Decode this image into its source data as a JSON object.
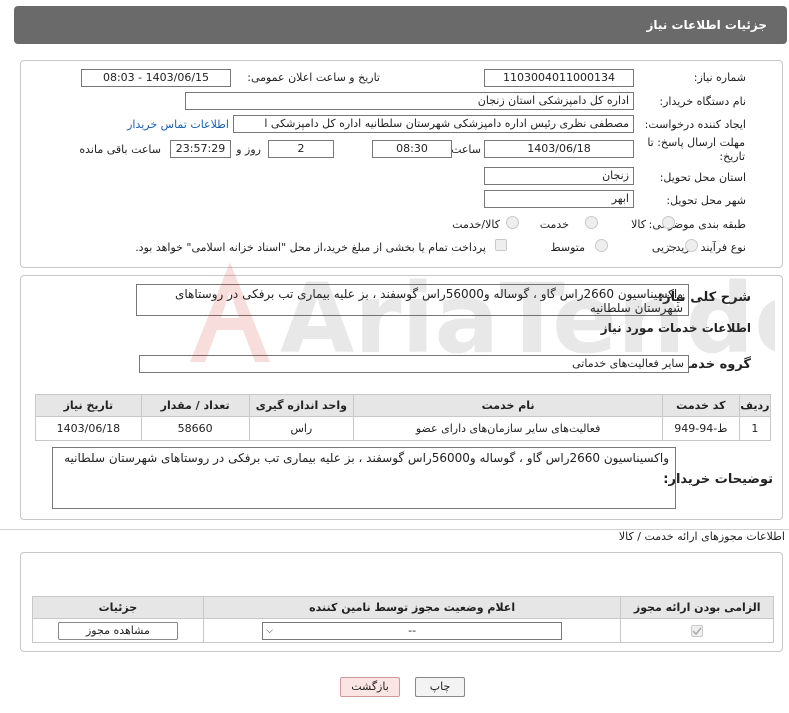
{
  "header": {
    "title": "جزئیات اطلاعات نیاز"
  },
  "fields": {
    "need_number_label": "شماره نیاز:",
    "need_number": "1103004011000134",
    "announce_label": "تاریخ و ساعت اعلان عمومی:",
    "announce_value": "1403/06/15 - 08:03",
    "buyer_label": "نام دستگاه خریدار:",
    "buyer_value": "اداره کل دامپزشکی استان زنجان",
    "creator_label": "ایجاد کننده درخواست:",
    "creator_value": "مصطفی نظری رئیس اداره دامپزشکی شهرستان سلطانیه اداره کل دامپزشکی ا",
    "contact_link": "اطلاعات تماس خریدار",
    "deadline_label": "مهلت ارسال پاسخ: تا تاریخ:",
    "deadline_date": "1403/06/18",
    "time_label": "ساعت",
    "deadline_time": "08:30",
    "days_value": "2",
    "days_label": "روز و",
    "remaining_time": "23:57:29",
    "remaining_label": "ساعت باقی مانده",
    "province_label": "استان محل تحویل:",
    "province_value": "زنجان",
    "city_label": "شهر محل تحویل:",
    "city_value": "ابهر",
    "category_label": "طبقه بندی موضوعی:",
    "cat_goods": "کالا",
    "cat_service": "خدمت",
    "cat_goods_service": "کالا/خدمت",
    "process_label": "نوع فرآیند خرید :",
    "proc_partial": "جزیی",
    "proc_medium": "متوسط",
    "payment_note": "پرداخت تمام یا بخشی از مبلغ خرید،از محل \"اسناد خزانه اسلامی\" خواهد بود."
  },
  "need": {
    "summary_label": "شرح کلی نیاز:",
    "summary_value": "واکسیناسیون 2660راس گاو ، گوساله و56000راس گوسفند ، بز علیه بیماری تب برفکی در روستاهای شهرستان سلطانیه",
    "services_heading": "اطلاعات خدمات مورد نیاز",
    "group_label": "گروه خدمت:",
    "group_value": "سایر فعالیت‌های خدماتی",
    "table": {
      "headers": [
        "ردیف",
        "کد خدمت",
        "نام خدمت",
        "واحد اندازه گیری",
        "تعداد / مقدار",
        "تاریخ نیاز"
      ],
      "rows": [
        [
          "1",
          "ط-94-949",
          "فعالیت‌های سایر سازمان‌های دارای عضو",
          "راس",
          "58660",
          "1403/06/18"
        ]
      ]
    },
    "buyer_notes_label": "توضیحات خریدار:",
    "buyer_notes_value": "واکسیناسیون 2660راس گاو ، گوساله و56000راس گوسفند ، بز علیه بیماری تب برفکی در روستاهای شهرستان سلطانیه"
  },
  "permits": {
    "heading": "اطلاعات مجوزهای ارائه خدمت / کالا",
    "headers": [
      "الزامی بودن ارائه مجوز",
      "اعلام وضعیت مجوز توسط نامین کننده",
      "جزئیات"
    ],
    "select_value": "--",
    "view_button": "مشاهده مجوز"
  },
  "footer": {
    "print_button": "چاپ",
    "back_button": "بازگشت"
  },
  "watermark": {
    "text": "AriaTender.neT"
  }
}
